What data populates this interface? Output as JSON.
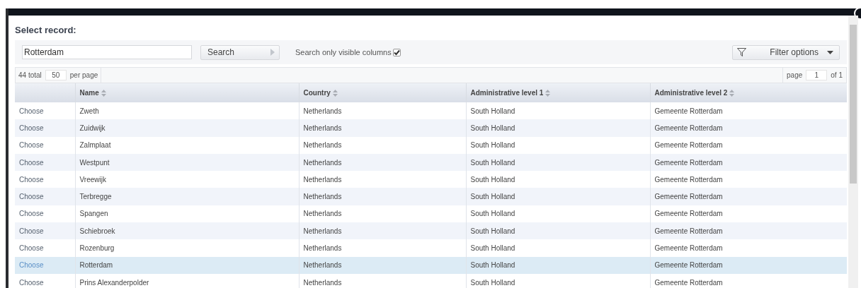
{
  "dialog": {
    "title": "Select record:"
  },
  "search": {
    "value": "Rotterdam",
    "button": "Search",
    "visible_only_label": "Search only visible columns",
    "visible_only_checked": true
  },
  "filter_button": "Filter options",
  "pager": {
    "total": "44 total",
    "per_page_value": "50",
    "per_page_label": "per page",
    "page_label": "page",
    "page_value": "1",
    "of_label": "of 1"
  },
  "table": {
    "columns": [
      "",
      "Name",
      "Country",
      "Administrative level 1",
      "Administrative level 2"
    ],
    "rows": [
      {
        "action": "Choose",
        "name": "Zweth",
        "country": "Netherlands",
        "admin1": "South Holland",
        "admin2": "Gemeente Rotterdam",
        "selected": false
      },
      {
        "action": "Choose",
        "name": "Zuidwijk",
        "country": "Netherlands",
        "admin1": "South Holland",
        "admin2": "Gemeente Rotterdam",
        "selected": false
      },
      {
        "action": "Choose",
        "name": "Zalmplaat",
        "country": "Netherlands",
        "admin1": "South Holland",
        "admin2": "Gemeente Rotterdam",
        "selected": false
      },
      {
        "action": "Choose",
        "name": "Westpunt",
        "country": "Netherlands",
        "admin1": "South Holland",
        "admin2": "Gemeente Rotterdam",
        "selected": false
      },
      {
        "action": "Choose",
        "name": "Vreewijk",
        "country": "Netherlands",
        "admin1": "South Holland",
        "admin2": "Gemeente Rotterdam",
        "selected": false
      },
      {
        "action": "Choose",
        "name": "Terbregge",
        "country": "Netherlands",
        "admin1": "South Holland",
        "admin2": "Gemeente Rotterdam",
        "selected": false
      },
      {
        "action": "Choose",
        "name": "Spangen",
        "country": "Netherlands",
        "admin1": "South Holland",
        "admin2": "Gemeente Rotterdam",
        "selected": false
      },
      {
        "action": "Choose",
        "name": "Schiebroek",
        "country": "Netherlands",
        "admin1": "South Holland",
        "admin2": "Gemeente Rotterdam",
        "selected": false
      },
      {
        "action": "Choose",
        "name": "Rozenburg",
        "country": "Netherlands",
        "admin1": "South Holland",
        "admin2": "Gemeente Rotterdam",
        "selected": false
      },
      {
        "action": "Choose",
        "name": "Rotterdam",
        "country": "Netherlands",
        "admin1": "South Holland",
        "admin2": "Gemeente Rotterdam",
        "selected": true
      },
      {
        "action": "Choose",
        "name": "Prins Alexanderpolder",
        "country": "Netherlands",
        "admin1": "South Holland",
        "admin2": "Gemeente Rotterdam",
        "selected": false
      }
    ]
  }
}
